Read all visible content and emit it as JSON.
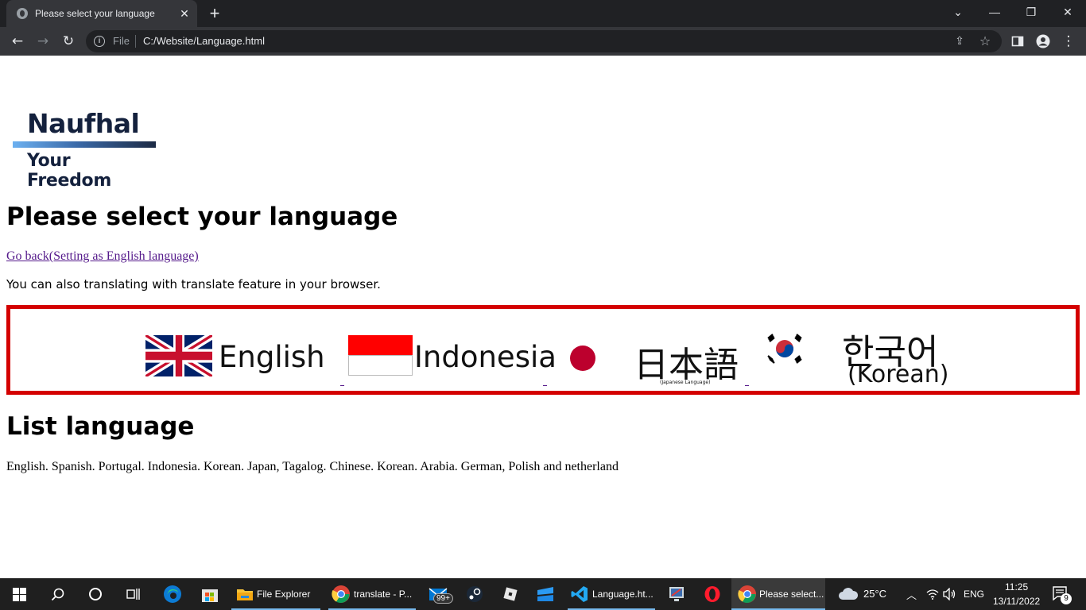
{
  "browser": {
    "tab_title": "Please select your language",
    "tab_close": "✕",
    "new_tab": "+",
    "address_scheme": "File",
    "address_url": "C:/Website/Language.html",
    "window_controls": {
      "minimize": "—",
      "restore": "❐",
      "close": "✕",
      "tab_search": "⌄"
    }
  },
  "page": {
    "logo": {
      "name": "Naufhal",
      "tagline": "Your Freedom"
    },
    "title": "Please select your language",
    "back_link": "Go back(Setting as English language)",
    "note": "You can also translating with translate feature in your browser.",
    "languages": [
      {
        "label": "English"
      },
      {
        "label": "Indonesia"
      },
      {
        "label": "日本語",
        "sublabel": "(Japanese Language)"
      },
      {
        "label": "한국어",
        "sublabel": "(Korean)"
      }
    ],
    "list_heading": "List language",
    "list_text": "English. Spanish. Portugal. Indonesia. Korean. Japan, Tagalog. Chinese. Korean. Arabia. German, Polish and netherland"
  },
  "taskbar": {
    "apps": [
      {
        "label": "File Explorer",
        "icon": "folder-icon"
      },
      {
        "label": "translate - P...",
        "icon": "chrome-icon"
      },
      {
        "label": "Language.ht...",
        "icon": "vscode-icon"
      },
      {
        "label": "Please select...",
        "icon": "chrome-icon"
      }
    ],
    "mail_badge": "99+",
    "weather": "25°C",
    "input_lang": "ENG",
    "time": "11:25",
    "date": "13/11/2022",
    "notifications": "9"
  },
  "colors": {
    "chrome_dark": "#202124",
    "chrome_toolbar": "#35363a",
    "link_visited": "#551a8b",
    "box_border": "#d40000",
    "taskbar": "#1f1f1f"
  }
}
